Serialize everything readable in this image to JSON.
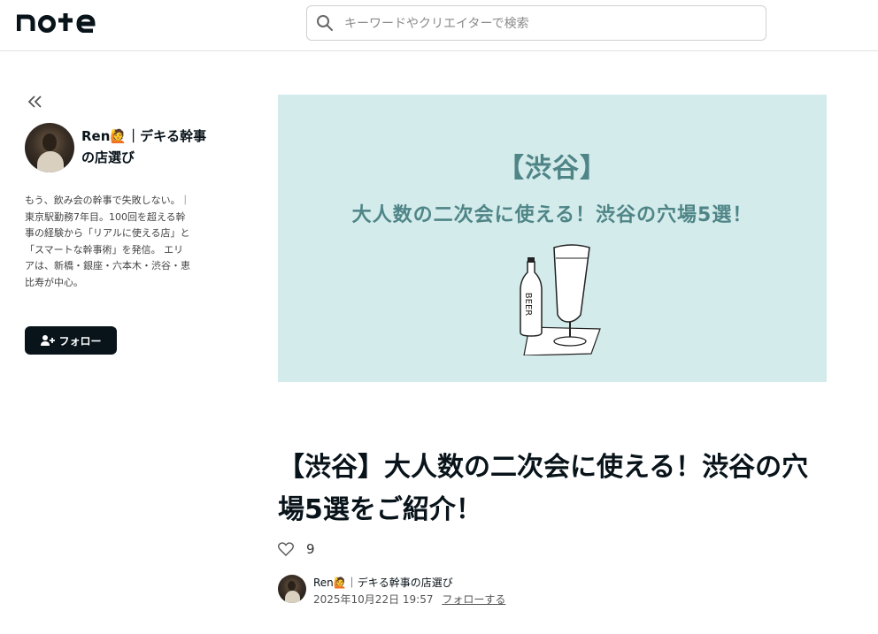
{
  "header": {
    "logo_text": "note",
    "search": {
      "placeholder": "キーワードやクリエイターで検索",
      "value": ""
    }
  },
  "sidebar": {
    "collapse_label": "«",
    "author_name": "Ren🙋｜デキる幹事の店選び",
    "bio": "もう、飲み会の幹事で失敗しない。｜東京駅勤務7年目。100回を超える幹事の経験から「リアルに使える店」と「スマートな幹事術」を発信。 エリアは、新橋・銀座・六本木・渋谷・恵比寿が中心。",
    "follow_button": "フォロー"
  },
  "hero": {
    "line1": "【渋谷】",
    "line2": "大人数の二次会に使える！渋谷の穴場5選！",
    "bottle_label": "BEER"
  },
  "article": {
    "title": "【渋谷】大人数の二次会に使える！渋谷の穴場5選をご紹介！",
    "likes": "9"
  },
  "byline": {
    "author": "Ren🙋｜デキる幹事の店選び",
    "datetime": "2025年10月22日 19:57",
    "follow_link": "フォローする"
  }
}
